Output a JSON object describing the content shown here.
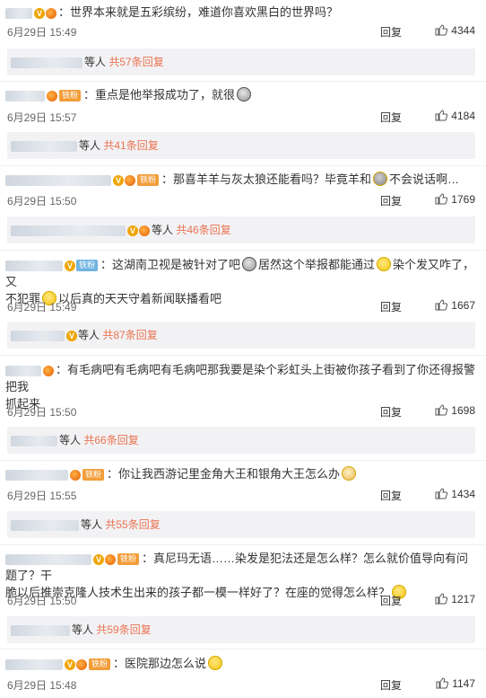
{
  "comments": [
    {
      "text": "：世界本来就是五彩缤纷，难道你喜欢黑白的世界吗？",
      "time": "6月29日 15:49",
      "reply_label": "回复",
      "likes": "4344",
      "replies_suffix": "等人",
      "replies_more": "共57条回复",
      "badge": ""
    },
    {
      "text": "：重点是他举报成功了，就很",
      "time": "6月29日 15:57",
      "reply_label": "回复",
      "likes": "4184",
      "replies_suffix": "等人",
      "replies_more": "共41条回复",
      "badge": "铁粉"
    },
    {
      "text": "：那喜羊羊与灰太狼还能看吗？毕竟羊和",
      "text2": "不会说话啊…",
      "time": "6月29日 15:50",
      "reply_label": "回复",
      "likes": "1769",
      "replies_suffix": "等人",
      "replies_more": "共46条回复",
      "badge": "铁粉"
    },
    {
      "text": "：这湖南卫视是被针对了吧",
      "text2": "居然这个举报都能通过",
      "text3": "染个发又咋了，又",
      "text4": "不犯罪",
      "text5": "以后真的天天守着新闻联播看吧",
      "time": "6月29日 15:49",
      "reply_label": "回复",
      "likes": "1667",
      "replies_suffix": "等人",
      "replies_more": "共87条回复",
      "badge": "铁粉"
    },
    {
      "text": "：有毛病吧有毛病吧有毛病吧那我要是染个彩虹头上街被你孩子看到了你还得报警把我",
      "text2": "抓起来",
      "time": "6月29日 15:50",
      "reply_label": "回复",
      "likes": "1698",
      "replies_suffix": "等人",
      "replies_more": "共66条回复",
      "badge": ""
    },
    {
      "text": "：你让我西游记里金角大王和银角大王怎么办",
      "time": "6月29日 15:55",
      "reply_label": "回复",
      "likes": "1434",
      "replies_suffix": "等人",
      "replies_more": "共55条回复",
      "badge": "铁粉"
    },
    {
      "text": "：真尼玛无语……染发是犯法还是怎么样？怎么就价值导向有问题了？干",
      "text2": "脆以后推崇克隆人技术生出来的孩子都一模一样好了？在座的觉得怎么样？",
      "time": "6月29日 15:50",
      "reply_label": "回复",
      "likes": "1217",
      "replies_suffix": "等人",
      "replies_more": "共59条回复",
      "badge": "铁粉"
    },
    {
      "text": "：医院那边怎么说",
      "time": "6月29日 15:48",
      "reply_label": "回复",
      "likes": "1147",
      "badge": "铁粉"
    }
  ],
  "icons": {
    "like": "thumbs-up-icon",
    "vip": "v-badge-icon"
  },
  "colors": {
    "link": "#eb7350",
    "badge": "#f29d38",
    "reply_bg": "#f2f2f5"
  }
}
